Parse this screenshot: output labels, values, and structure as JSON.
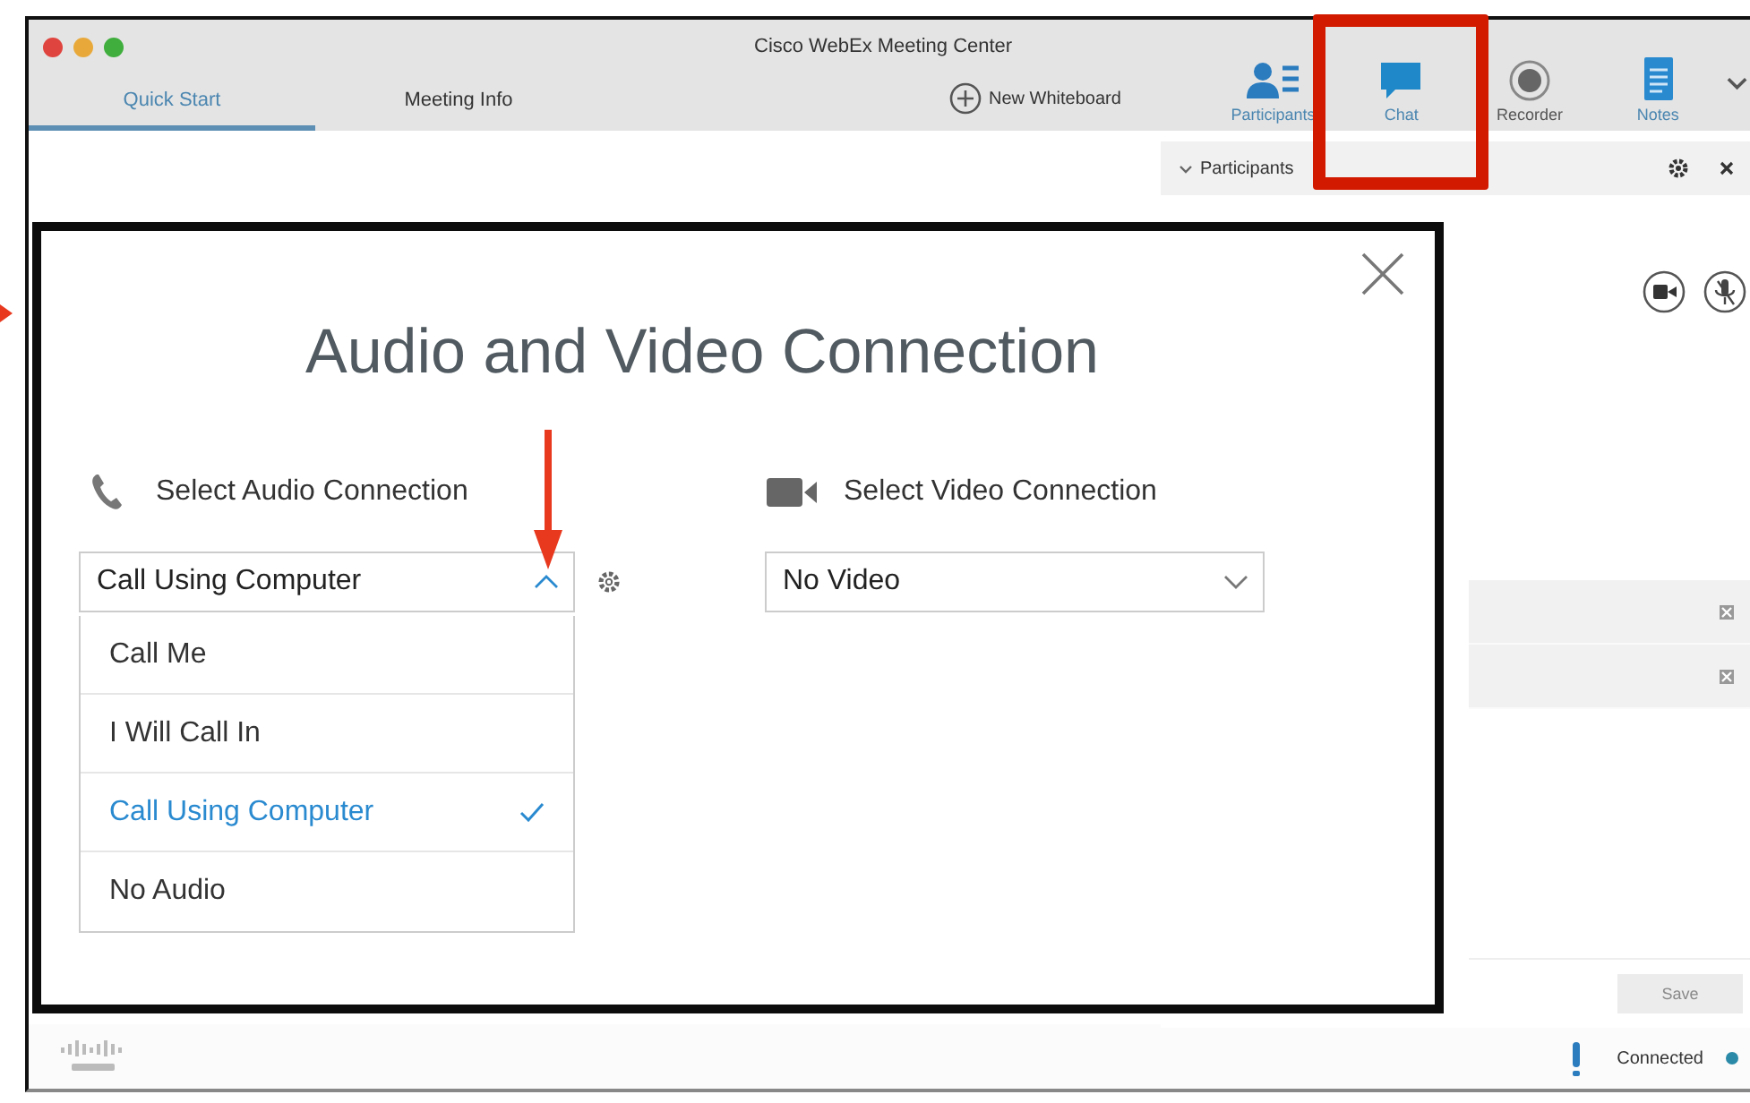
{
  "window": {
    "title": "Cisco WebEx Meeting Center"
  },
  "tabs": [
    {
      "label": "Quick Start",
      "selected": true
    },
    {
      "label": "Meeting Info",
      "selected": false
    }
  ],
  "new_whiteboard": {
    "label": "New Whiteboard"
  },
  "toolbar": [
    {
      "kind": "participants",
      "label": "Participants"
    },
    {
      "kind": "chat",
      "label": "Chat"
    },
    {
      "kind": "recorder",
      "label": "Recorder"
    },
    {
      "kind": "notes",
      "label": "Notes"
    }
  ],
  "participants_panel": {
    "title": "Participants",
    "expanded": true,
    "save_button": {
      "label": "Save",
      "disabled": true
    }
  },
  "status_bar": {
    "connection": "Connected"
  },
  "dialog": {
    "title": "Audio and Video Connection",
    "audio": {
      "label": "Select Audio Connection",
      "value": "Call Using Computer",
      "expanded": true,
      "options": [
        {
          "label": "Call Me",
          "selected": false
        },
        {
          "label": "I Will Call In",
          "selected": false
        },
        {
          "label": "Call Using Computer",
          "selected": true
        },
        {
          "label": "No Audio",
          "selected": false
        }
      ]
    },
    "video": {
      "label": "Select Video Connection",
      "value": "No Video",
      "expanded": false
    }
  },
  "annotations": [
    {
      "kind": "box"
    },
    {
      "kind": "arrow"
    },
    {
      "kind": "pointer"
    }
  ]
}
